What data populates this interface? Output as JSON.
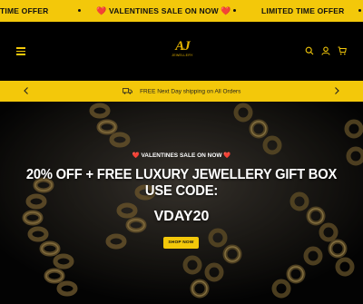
{
  "announcement": {
    "items": [
      {
        "text": "TIME OFFER"
      },
      {
        "text": "VALENTINES SALE ON NOW"
      },
      {
        "text": "LIMITED TIME OFFER"
      }
    ],
    "heart": "❤️",
    "bg_color": "#f3c80a"
  },
  "header": {
    "logo_mark": "AJ",
    "logo_sub": "JEWELLERY",
    "icons": [
      "menu-icon",
      "search-icon",
      "account-icon",
      "cart-icon"
    ]
  },
  "shipping": {
    "text": "FREE Next Day shipping on All Orders",
    "icon": "truck-icon"
  },
  "hero": {
    "eyebrow": "VALENTINES SALE ON NOW",
    "heart": "❤️",
    "headline_line1": "20% OFF + FREE LUXURY JEWELLERY GIFT BOX",
    "headline_line2": "USE CODE:",
    "code": "VDAY20",
    "button": "SHOP NOW",
    "accent": "#f3c80a"
  }
}
